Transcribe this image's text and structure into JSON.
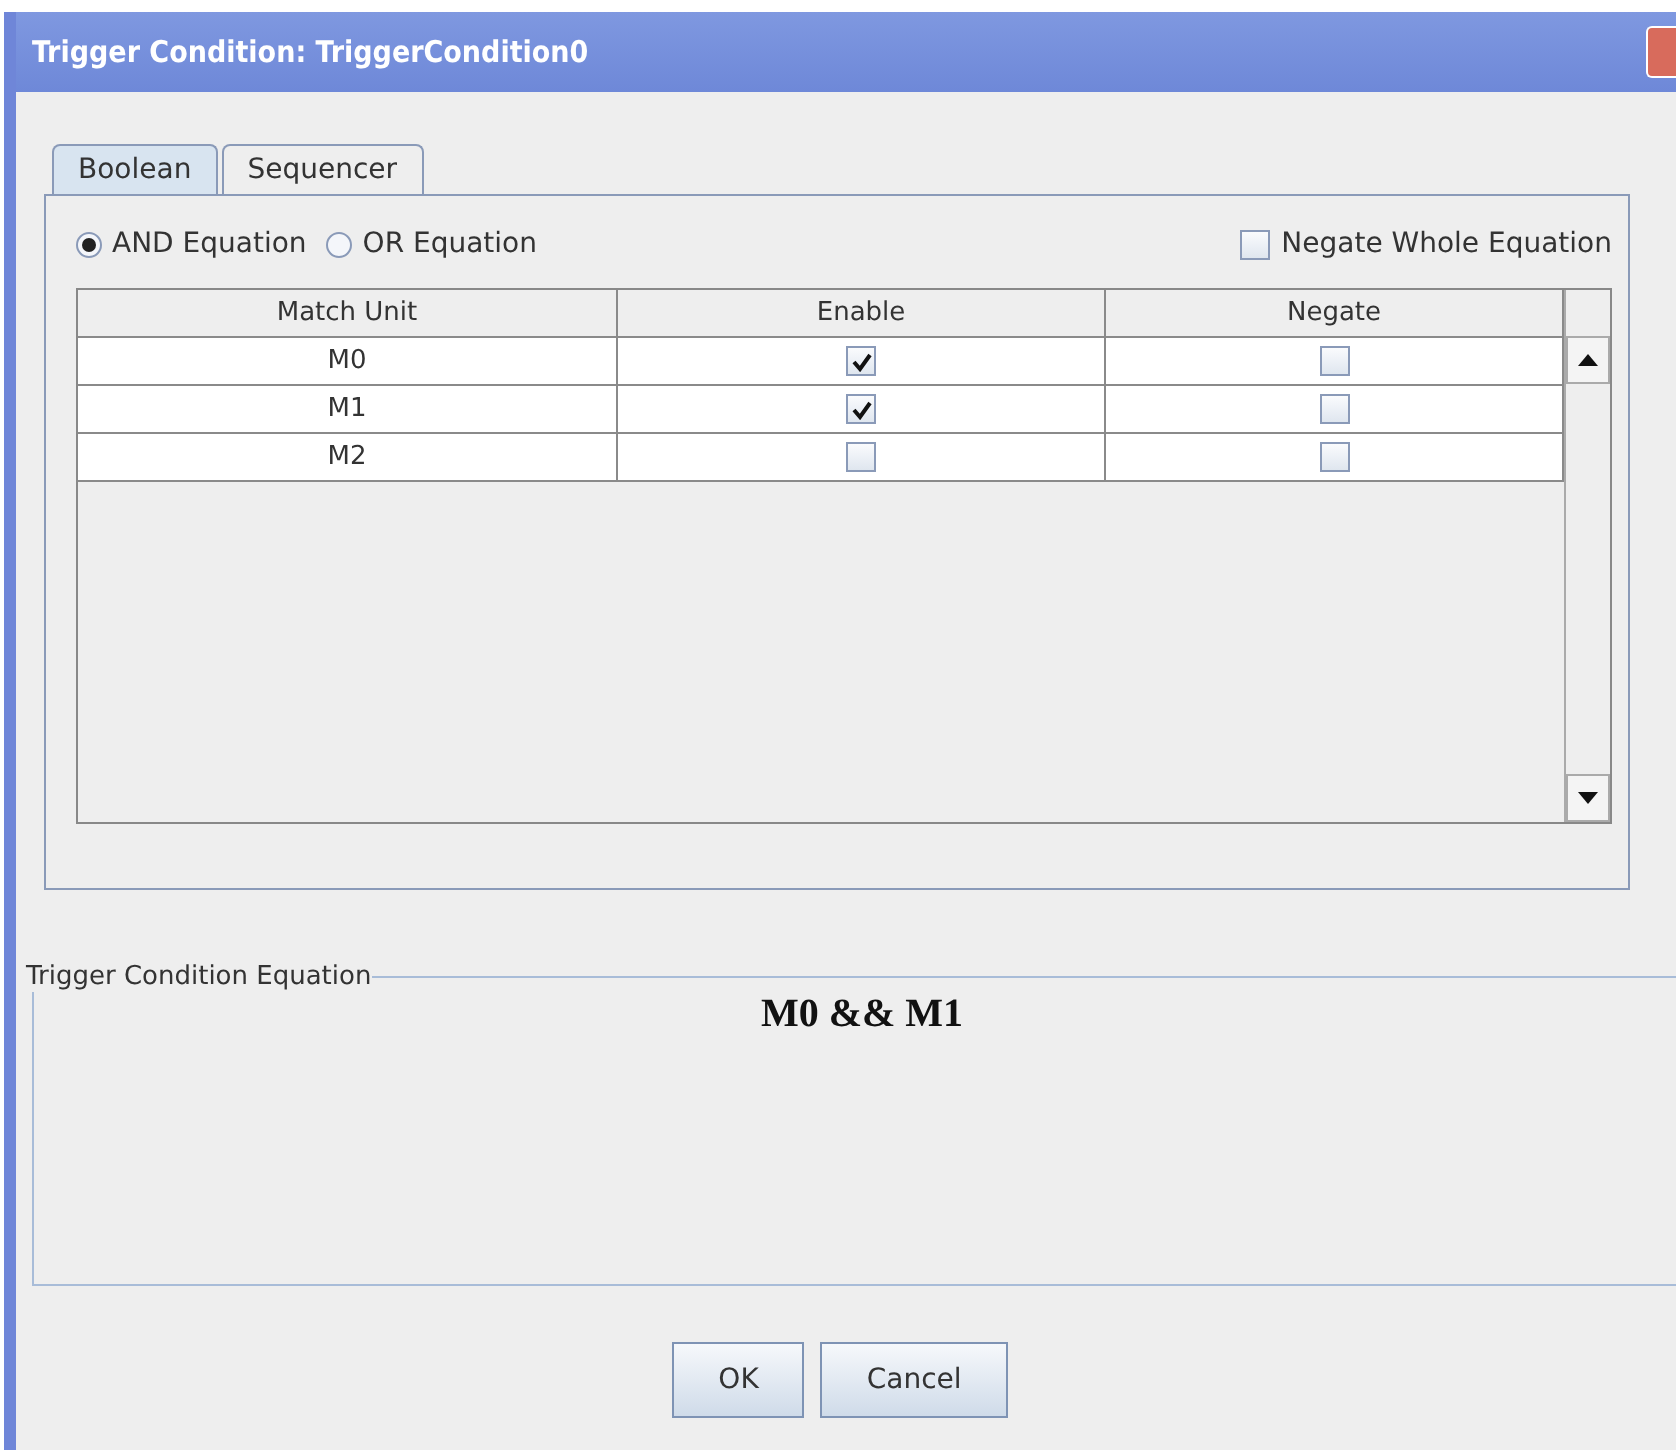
{
  "window": {
    "title": "Trigger Condition: TriggerCondition0"
  },
  "tabs": [
    {
      "label": "Boolean",
      "selected": true
    },
    {
      "label": "Sequencer",
      "selected": false
    }
  ],
  "equation_type": [
    {
      "label": "AND Equation",
      "selected": true
    },
    {
      "label": "OR Equation",
      "selected": false
    }
  ],
  "negate_whole": {
    "label": "Negate Whole Equation",
    "checked": false
  },
  "table": {
    "columns": [
      "Match Unit",
      "Enable",
      "Negate"
    ],
    "rows": [
      {
        "unit": "M0",
        "enable": true,
        "negate": false
      },
      {
        "unit": "M1",
        "enable": true,
        "negate": false
      },
      {
        "unit": "M2",
        "enable": false,
        "negate": false
      }
    ]
  },
  "equation": {
    "title": "Trigger Condition Equation",
    "text": "M0 && M1"
  },
  "buttons": [
    "OK",
    "Cancel"
  ]
}
